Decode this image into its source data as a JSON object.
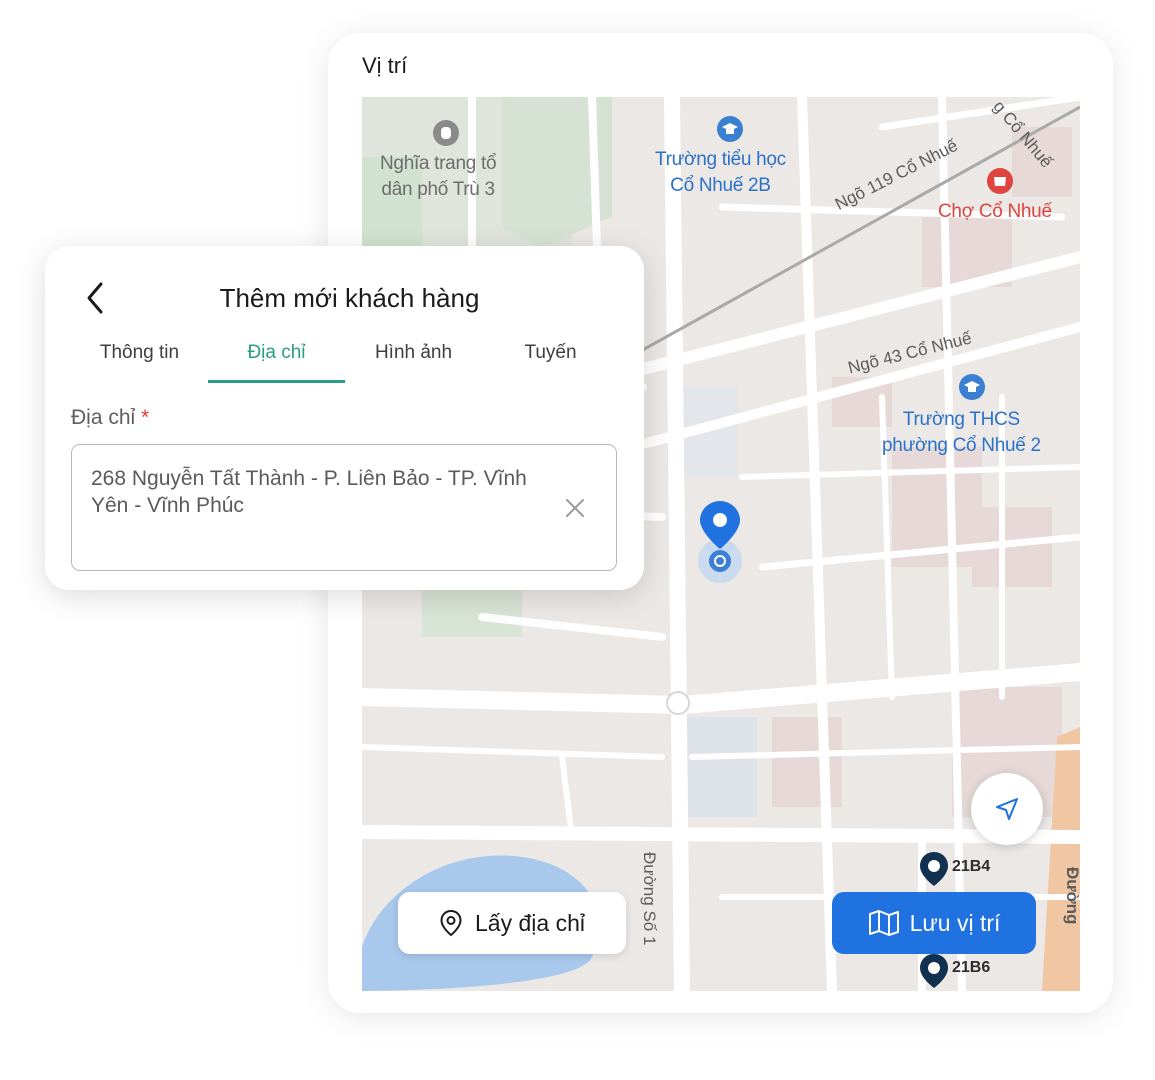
{
  "map_card": {
    "title": "Vị trí",
    "map": {
      "poi_labels": [
        {
          "text_line1": "Nghĩa trang tổ",
          "text_line2": "dân phố Trù 3"
        },
        {
          "text_line1": "Trường tiểu học",
          "text_line2": "Cổ Nhuế 2B"
        },
        {
          "text_line1": "Chợ Cổ Nhuế"
        },
        {
          "text_line1": "Trường THCS",
          "text_line2": "phường Cổ Nhuế 2"
        }
      ],
      "road_labels": [
        "Ngõ 119 Cổ Nhuế",
        "Ngõ 43 Cổ Nhuế",
        "Đường Số 1",
        "g Cổ Nhuế",
        "Đường"
      ],
      "pins": [
        "21B4",
        "21B6"
      ]
    },
    "get_address_label": "Lấy địa chỉ",
    "save_location_label": "Lưu vị trí"
  },
  "form_card": {
    "title": "Thêm mới khách hàng",
    "tabs": [
      {
        "label": "Thông tin",
        "active": false
      },
      {
        "label": "Địa chỉ",
        "active": true
      },
      {
        "label": "Hình ảnh",
        "active": false
      },
      {
        "label": "Tuyến",
        "active": false
      }
    ],
    "address_label": "Địa chỉ",
    "required_mark": "*",
    "address_value": "268 Nguyễn Tất Thành - P. Liên Bảo - TP. Vĩnh Yên - Vĩnh Phúc"
  },
  "colors": {
    "accent_teal": "#2a9d84",
    "primary_blue": "#1f72e0",
    "required_red": "#e53935"
  },
  "icons": [
    "chevron-left-icon",
    "close-icon",
    "map-pin-icon",
    "navigation-arrow-icon",
    "map-fold-icon",
    "user-location-marker-icon"
  ]
}
